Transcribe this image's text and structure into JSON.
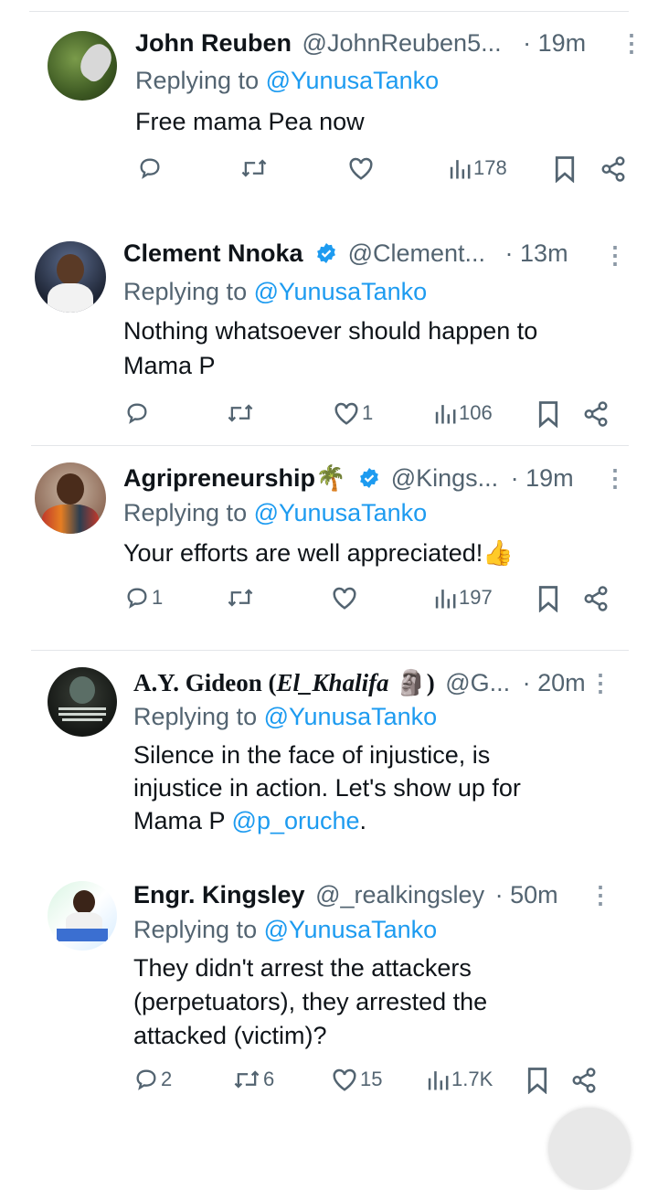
{
  "tweets": [
    {
      "name": "John Reuben",
      "emoji": "",
      "handle": "@JohnReuben5...",
      "time": "· 19m",
      "replying_label": "Replying to",
      "replying_to": "@YunusaTanko",
      "text_lines": [
        "Free mama Pea now"
      ],
      "verified": false,
      "counts": {
        "reply": "",
        "retweet": "",
        "like": "",
        "views": "178"
      }
    },
    {
      "name": "Clement Nnoka",
      "emoji": "",
      "handle": "@Clement...",
      "time": "· 13m",
      "replying_label": "Replying to",
      "replying_to": "@YunusaTanko",
      "text_lines": [
        "Nothing whatsoever should happen to",
        "Mama P"
      ],
      "verified": true,
      "counts": {
        "reply": "",
        "retweet": "",
        "like": "1",
        "views": "106"
      }
    },
    {
      "name": "Agripreneurship",
      "emoji": "🌴",
      "handle": "@Kings...",
      "time": "· 19m",
      "replying_label": "Replying to",
      "replying_to": "@YunusaTanko",
      "text_lines": [
        "Your efforts are well appreciated!👍"
      ],
      "verified": true,
      "counts": {
        "reply": "1",
        "retweet": "",
        "like": "",
        "views": "197"
      }
    },
    {
      "name": "A.Y. Gideon (",
      "name_italic": "El_Khalifa",
      "name_emoji": "🗿",
      "name_end": ")",
      "handle": "@G...",
      "time": "· 20m",
      "replying_label": "Replying to",
      "replying_to": "@YunusaTanko",
      "text_lines": [
        "Silence in the face of injustice, is",
        "injustice in action.  Let's show up for"
      ],
      "text_last_prefix": "Mama P ",
      "text_last_mention": "@p_oruche",
      "text_last_suffix": ".",
      "verified": false
    },
    {
      "name": "Engr. Kingsley",
      "emoji": "",
      "handle": "@_realkingsley",
      "time": "· 50m",
      "replying_label": "Replying to",
      "replying_to": "@YunusaTanko",
      "text_lines": [
        "They didn't arrest the attackers",
        "(perpetuators), they arrested the",
        "attacked (victim)?"
      ],
      "verified": false,
      "counts": {
        "reply": "2",
        "retweet": "6",
        "like": "15",
        "views": "1.7K"
      }
    }
  ],
  "colors": {
    "text": "#0f1419",
    "secondary": "#536471",
    "link": "#1d9bf0",
    "verified": "#1d9bf0",
    "divider": "#e3e6e9"
  },
  "icons": [
    "reply-icon",
    "retweet-icon",
    "like-icon",
    "views-icon",
    "bookmark-icon",
    "share-icon",
    "more-icon",
    "verified-badge-icon"
  ]
}
